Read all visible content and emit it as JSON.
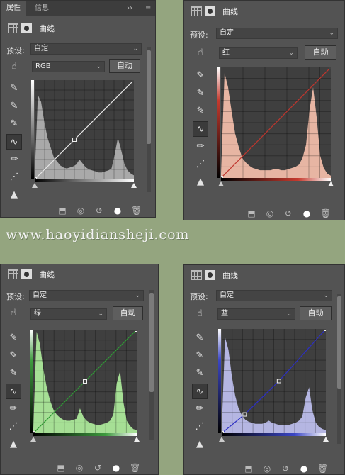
{
  "watermark": "www.haoyidiansheji.com",
  "tabs": {
    "properties": "属性",
    "info": "信息",
    "collapse": "››"
  },
  "panel_title": "曲线",
  "preset_label": "预设:",
  "preset_value": "自定",
  "auto_label": "自动",
  "icons": {
    "adjust": "hand-target-icon",
    "tools": [
      "set-white-point-icon",
      "set-gray-point-icon",
      "set-black-point-icon",
      "curve-edit-icon",
      "pencil-icon",
      "smooth-icon",
      "clip-warning-icon"
    ],
    "footer": [
      "clip-to-layer-icon",
      "view-previous-icon",
      "reset-icon",
      "visibility-icon",
      "delete-icon"
    ]
  },
  "panels": [
    {
      "id": "rgb",
      "channel": "RGB",
      "bar_color": "#6e6e6e",
      "fill": "#a9a9a9",
      "line": "#e6e6e6",
      "curve": [
        [
          0,
          0
        ],
        [
          0.4,
          0.4
        ],
        [
          1,
          1
        ]
      ],
      "hist": [
        0.05,
        0.85,
        0.78,
        0.58,
        0.42,
        0.32,
        0.22,
        0.18,
        0.14,
        0.12,
        0.11,
        0.12,
        0.13,
        0.15,
        0.2,
        0.16,
        0.12,
        0.1,
        0.09,
        0.08,
        0.07,
        0.07,
        0.08,
        0.09,
        0.11,
        0.25,
        0.42,
        0.3,
        0.16,
        0.09,
        0.06,
        0.04
      ]
    },
    {
      "id": "red",
      "channel": "红",
      "bar_color": "#c53a2e",
      "fill": "#e7b5a3",
      "line": "#c0362e",
      "curve": [
        [
          0,
          0
        ],
        [
          1,
          1
        ]
      ],
      "hist": [
        0.04,
        0.95,
        0.82,
        0.6,
        0.4,
        0.28,
        0.18,
        0.14,
        0.11,
        0.09,
        0.08,
        0.07,
        0.07,
        0.07,
        0.07,
        0.08,
        0.08,
        0.07,
        0.07,
        0.08,
        0.09,
        0.1,
        0.12,
        0.18,
        0.3,
        0.62,
        0.82,
        0.55,
        0.2,
        0.09,
        0.04,
        0.02
      ]
    },
    {
      "id": "green",
      "channel": "绿",
      "bar_color": "#3e9a3e",
      "fill": "#a6df95",
      "line": "#2f9a35",
      "curve": [
        [
          0,
          0
        ],
        [
          0.5,
          0.5
        ],
        [
          1,
          1
        ]
      ],
      "hist": [
        0.04,
        0.98,
        0.86,
        0.62,
        0.45,
        0.32,
        0.23,
        0.18,
        0.15,
        0.13,
        0.12,
        0.12,
        0.13,
        0.14,
        0.24,
        0.16,
        0.12,
        0.1,
        0.09,
        0.08,
        0.08,
        0.09,
        0.1,
        0.12,
        0.18,
        0.48,
        0.6,
        0.3,
        0.12,
        0.07,
        0.04,
        0.03
      ]
    },
    {
      "id": "blue",
      "channel": "蓝",
      "bar_color": "#3b46c4",
      "fill": "#b5b6e2",
      "line": "#2c2fc4",
      "curve": [
        [
          0,
          0
        ],
        [
          0.22,
          0.18
        ],
        [
          0.55,
          0.5
        ],
        [
          1,
          1
        ]
      ],
      "hist": [
        0.04,
        0.92,
        0.8,
        0.55,
        0.36,
        0.24,
        0.17,
        0.13,
        0.11,
        0.1,
        0.09,
        0.09,
        0.09,
        0.1,
        0.12,
        0.1,
        0.09,
        0.08,
        0.08,
        0.08,
        0.08,
        0.09,
        0.1,
        0.12,
        0.16,
        0.34,
        0.44,
        0.22,
        0.1,
        0.06,
        0.04,
        0.03
      ]
    }
  ]
}
